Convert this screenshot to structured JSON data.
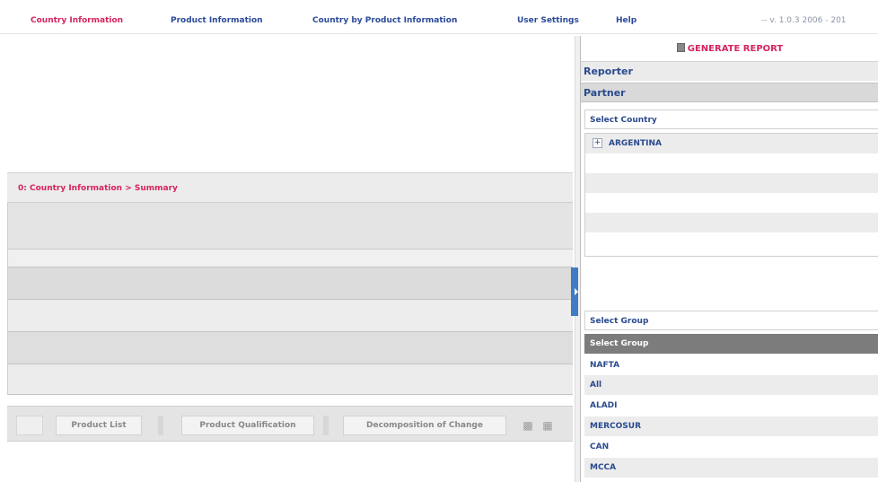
{
  "nav": {
    "items": [
      {
        "label": "Country Information",
        "active": true
      },
      {
        "label": "Product Information",
        "active": false
      },
      {
        "label": "Country by Product Information",
        "active": false
      },
      {
        "label": "User Settings",
        "active": false
      },
      {
        "label": "Help",
        "active": false
      }
    ],
    "version": "-- v. 1.0.3 2006 - 201"
  },
  "breadcrumb": "0: Country Information > Summary",
  "toolbar": {
    "product_list": "Product List",
    "product_qualification": "Product Qualification",
    "decomposition": "Decomposition of Change"
  },
  "right_panel": {
    "generate_label": "GENERATE REPORT",
    "reporter_label": "Reporter",
    "partner_label": "Partner",
    "select_country_label": "Select Country",
    "countries": [
      {
        "toggle": "+",
        "name": "ARGENTINA"
      }
    ],
    "select_group_label": "Select Group",
    "group_header": "Select Group",
    "groups": [
      "NAFTA",
      "All",
      "ALADI",
      "MERCOSUR",
      "CAN",
      "MCCA"
    ]
  },
  "colors": {
    "active_nav": "#d6245c",
    "nav_link": "#2b4a9a",
    "panel_text": "#2a4a8e",
    "splitter_handle": "#3e7cc4",
    "group_header_bg": "#7c7c7c"
  }
}
